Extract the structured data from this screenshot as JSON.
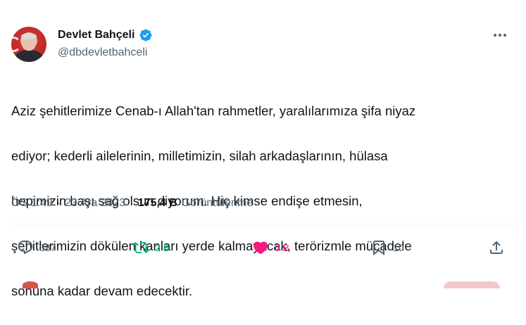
{
  "author": {
    "name": "Devlet Bahçeli",
    "handle": "@dbdevletbahceli",
    "verified": true,
    "verified_color": "#1d9bf0"
  },
  "tweet": {
    "lines": [
      "Aziz şehitlerimize Cenab-ı Allah'tan rahmetler, yaralılarımıza şifa niyaz",
      "ediyor; kederli ailelerinin, milletimizin, silah arkadaşlarının, hülasa",
      "hepimizin başı sağ olsun diyorum. Hiç kimse endişe etmesin,",
      "şehitlerimizin dökülen kanları yerde kalmayacak, terörizmle mücadele",
      "sonuna kadar devam edecektir."
    ]
  },
  "meta": {
    "time": "ÖS 1:49",
    "sep1": "·",
    "date": "23 Ara 2023",
    "sep2": "·",
    "views": "175,4 B",
    "views_label": "Görüntülenme"
  },
  "actions": {
    "reply": {
      "icon": "reply-icon",
      "count": "387"
    },
    "retweet": {
      "icon": "retweet-icon",
      "count": "2 B",
      "color": "#00ba7c"
    },
    "like": {
      "icon": "heart-icon",
      "count": "6 B",
      "color": "#f91880"
    },
    "bookmark": {
      "icon": "bookmark-icon",
      "count": "10"
    },
    "share": {
      "icon": "share-icon"
    }
  },
  "colors": {
    "text": "#0f1419",
    "secondary": "#536471",
    "divider": "#eff3f4"
  }
}
